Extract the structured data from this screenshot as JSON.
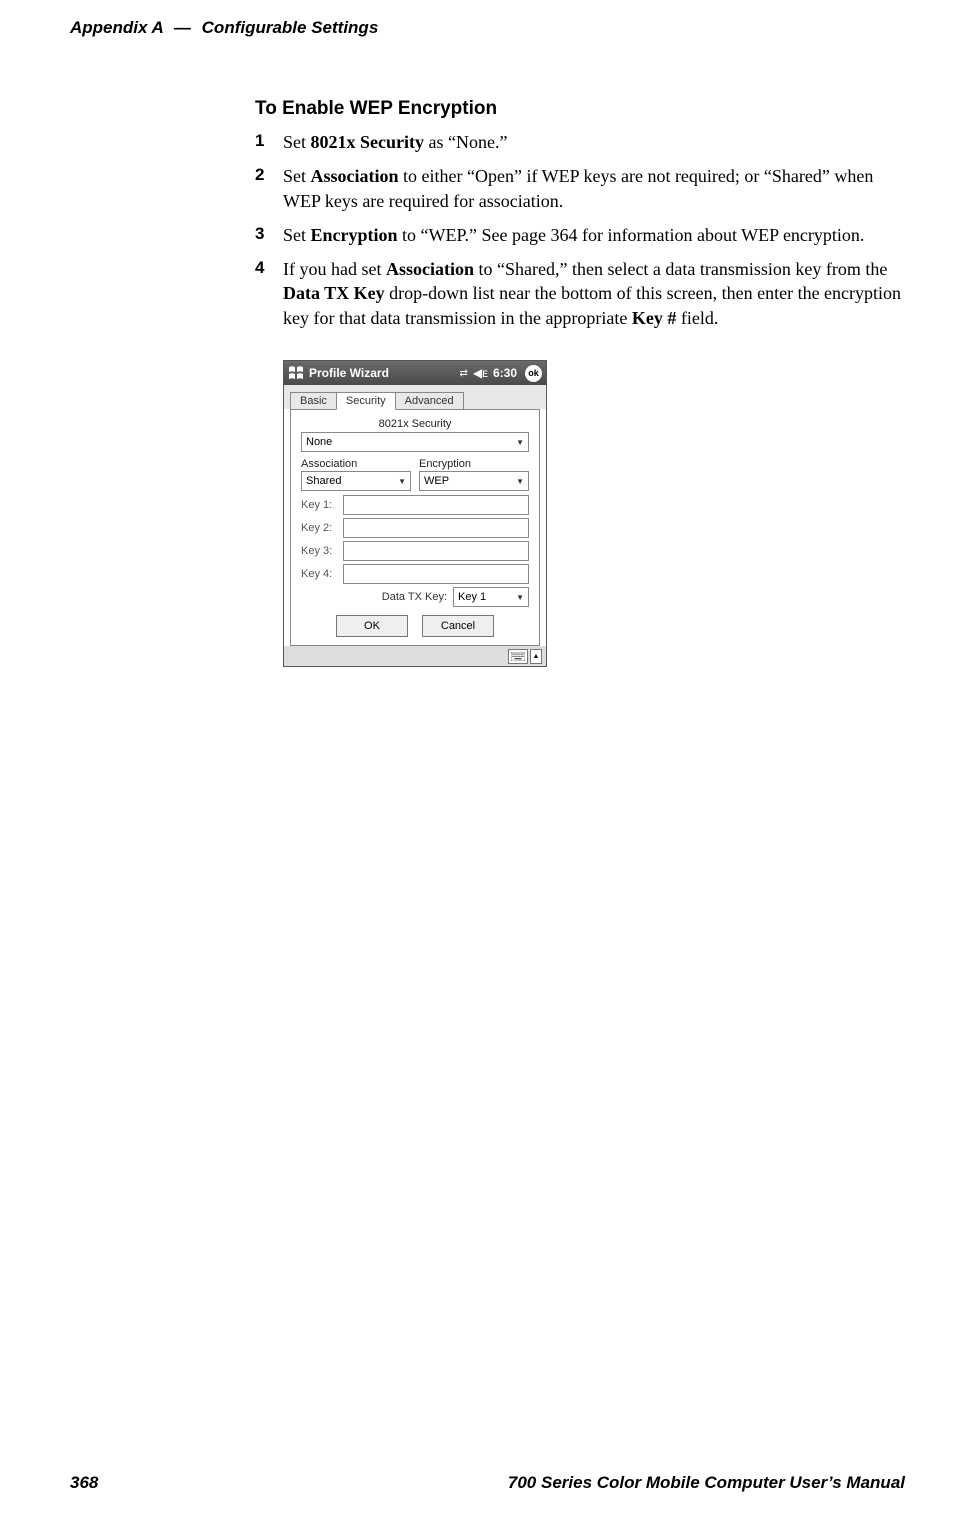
{
  "header": {
    "appendix": "Appendix A",
    "dash": "—",
    "title": "Configurable Settings"
  },
  "section": {
    "heading": "To Enable WEP Encryption",
    "steps": [
      {
        "num": "1",
        "pre": "Set ",
        "b1": "8021x Security",
        "post": " as “None.”"
      },
      {
        "num": "2",
        "pre": "Set ",
        "b1": "Association",
        "post": " to either “Open” if WEP keys are not required; or “Shared” when WEP keys are required for association."
      },
      {
        "num": "3",
        "pre": "Set ",
        "b1": "Encryption",
        "post": " to “WEP.” See page 364 for information about WEP encryption."
      },
      {
        "num": "4",
        "pre": "If you had set ",
        "b1": "Association",
        "mid1": " to “Shared,” then select a data transmission key from the ",
        "b2": "Data TX Key",
        "mid2": " drop-down list near the bottom of this screen, then enter the encryption key for that data transmission in the appropriate ",
        "b3": "Key #",
        "post": " field."
      }
    ]
  },
  "screenshot": {
    "title": "Profile Wizard",
    "time": "6:30",
    "ok": "ok",
    "tabs": {
      "basic": "Basic",
      "security": "Security",
      "advanced": "Advanced"
    },
    "sec_label": "8021x Security",
    "sec_value": "None",
    "assoc_label": "Association",
    "assoc_value": "Shared",
    "enc_label": "Encryption",
    "enc_value": "WEP",
    "keys": [
      "Key 1:",
      "Key 2:",
      "Key 3:",
      "Key 4:"
    ],
    "tx_label": "Data TX Key:",
    "tx_value": "Key 1",
    "ok_btn": "OK",
    "cancel_btn": "Cancel"
  },
  "footer": {
    "page": "368",
    "doc": "700 Series Color Mobile Computer User’s Manual"
  }
}
